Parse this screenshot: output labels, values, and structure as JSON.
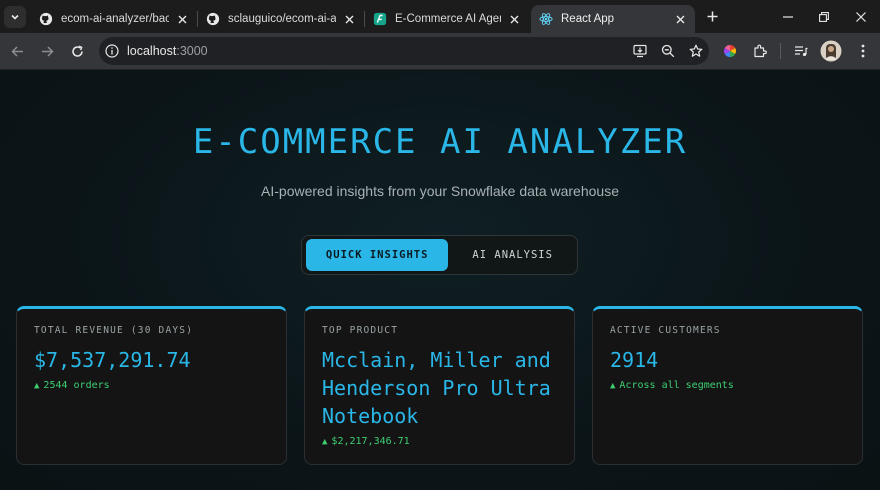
{
  "browser": {
    "tabs": [
      {
        "title": "ecom-ai-analyzer/backen",
        "icon": "github-icon"
      },
      {
        "title": "sclauguico/ecom-ai-analy",
        "icon": "github-icon"
      },
      {
        "title": "E-Commerce AI Agents A",
        "icon": "flowise-icon"
      },
      {
        "title": "React App",
        "icon": "react-icon"
      }
    ],
    "url_host": "localhost",
    "url_port": ":3000"
  },
  "hero": {
    "title": "E-COMMERCE AI ANALYZER",
    "subtitle": "AI-powered insights from your Snowflake data warehouse"
  },
  "view_tabs": {
    "quick": "QUICK INSIGHTS",
    "ai": "AI ANALYSIS"
  },
  "cards": [
    {
      "label": "TOTAL REVENUE (30 DAYS)",
      "value": "$7,537,291.74",
      "delta": "2544 orders"
    },
    {
      "label": "TOP PRODUCT",
      "value": "Mcclain, Miller and Henderson Pro Ultra Notebook",
      "delta": "$2,217,346.71"
    },
    {
      "label": "ACTIVE CUSTOMERS",
      "value": "2914",
      "delta": "Across all segments"
    }
  ],
  "colors": {
    "accent": "#2ab7e8",
    "positive": "#3ecf73"
  }
}
